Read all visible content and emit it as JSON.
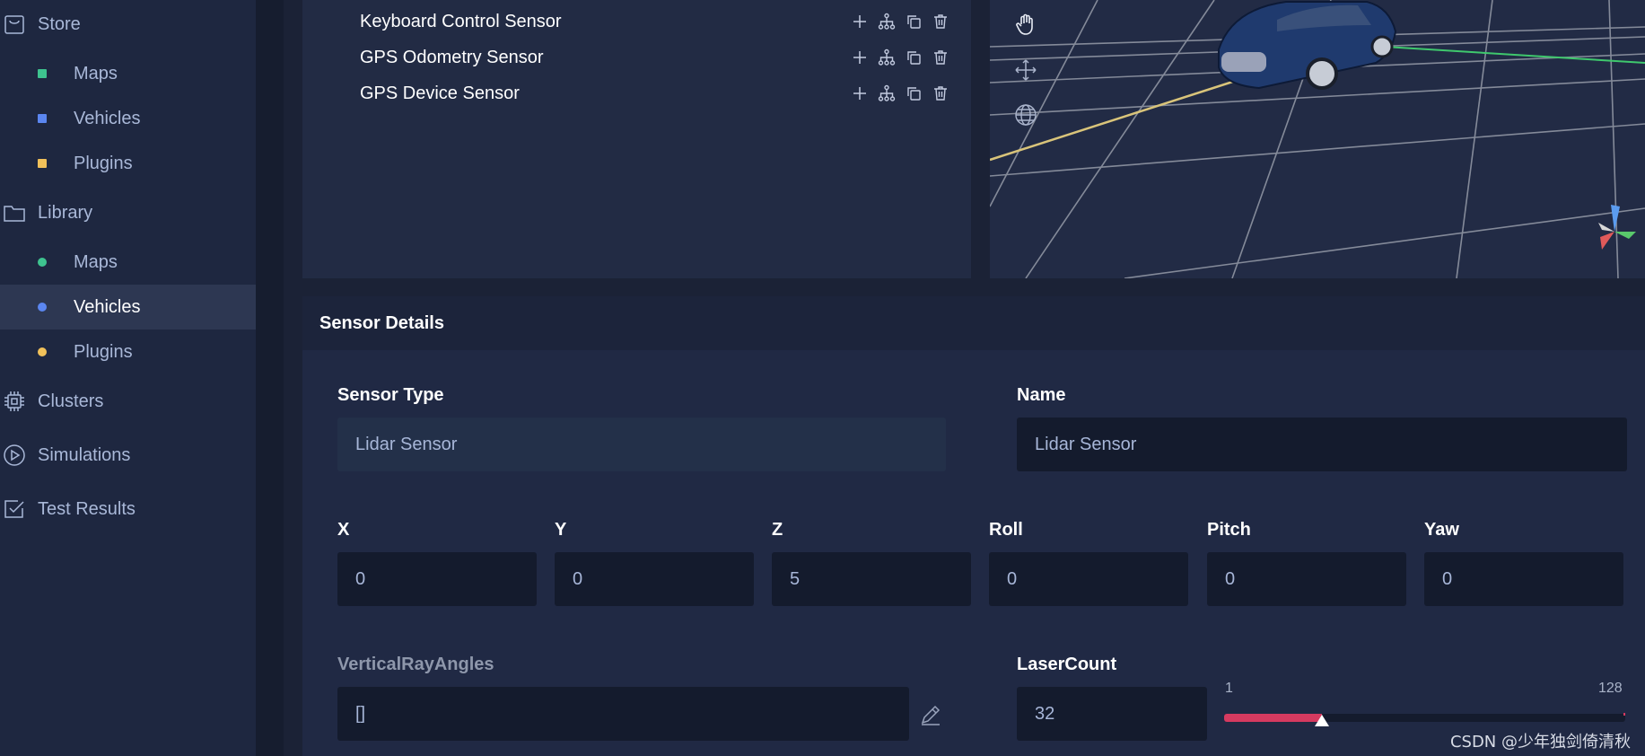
{
  "sidebar": {
    "store": {
      "label": "Store",
      "items": [
        {
          "label": "Maps",
          "color": "#3ec38f"
        },
        {
          "label": "Vehicles",
          "color": "#5b86f0"
        },
        {
          "label": "Plugins",
          "color": "#f1c15a"
        }
      ]
    },
    "library": {
      "label": "Library",
      "items": [
        {
          "label": "Maps",
          "color": "#3ec38f"
        },
        {
          "label": "Vehicles",
          "color": "#5b86f0",
          "active": true
        },
        {
          "label": "Plugins",
          "color": "#f1c15a"
        }
      ]
    },
    "clusters": "Clusters",
    "simulations": "Simulations",
    "test_results": "Test Results"
  },
  "sensor_tree": {
    "rows": [
      {
        "label": "Keyboard Control Sensor"
      },
      {
        "label": "GPS Odometry Sensor"
      },
      {
        "label": "GPS Device Sensor"
      }
    ],
    "actions": [
      "plus-icon",
      "hierarchy-icon",
      "copy-icon",
      "trash-icon"
    ]
  },
  "viewport": {
    "tools": [
      "hand-icon",
      "move-icon",
      "globe-icon"
    ]
  },
  "details": {
    "title": "Sensor Details",
    "sensor_type": {
      "label": "Sensor Type",
      "value": "Lidar Sensor"
    },
    "name": {
      "label": "Name",
      "value": "Lidar Sensor"
    },
    "transform": {
      "x": {
        "label": "X",
        "value": "0"
      },
      "y": {
        "label": "Y",
        "value": "0"
      },
      "z": {
        "label": "Z",
        "value": "5"
      },
      "roll": {
        "label": "Roll",
        "value": "0"
      },
      "pitch": {
        "label": "Pitch",
        "value": "0"
      },
      "yaw": {
        "label": "Yaw",
        "value": "0"
      }
    },
    "vertical_ray_angles": {
      "label": "VerticalRayAngles",
      "value": "[]"
    },
    "laser_count": {
      "label": "LaserCount",
      "value": "32",
      "min": "1",
      "max": "128",
      "fraction": 0.244
    }
  },
  "colors": {
    "accent": "#d63a60"
  },
  "watermark": "CSDN @少年独剑倚清秋"
}
